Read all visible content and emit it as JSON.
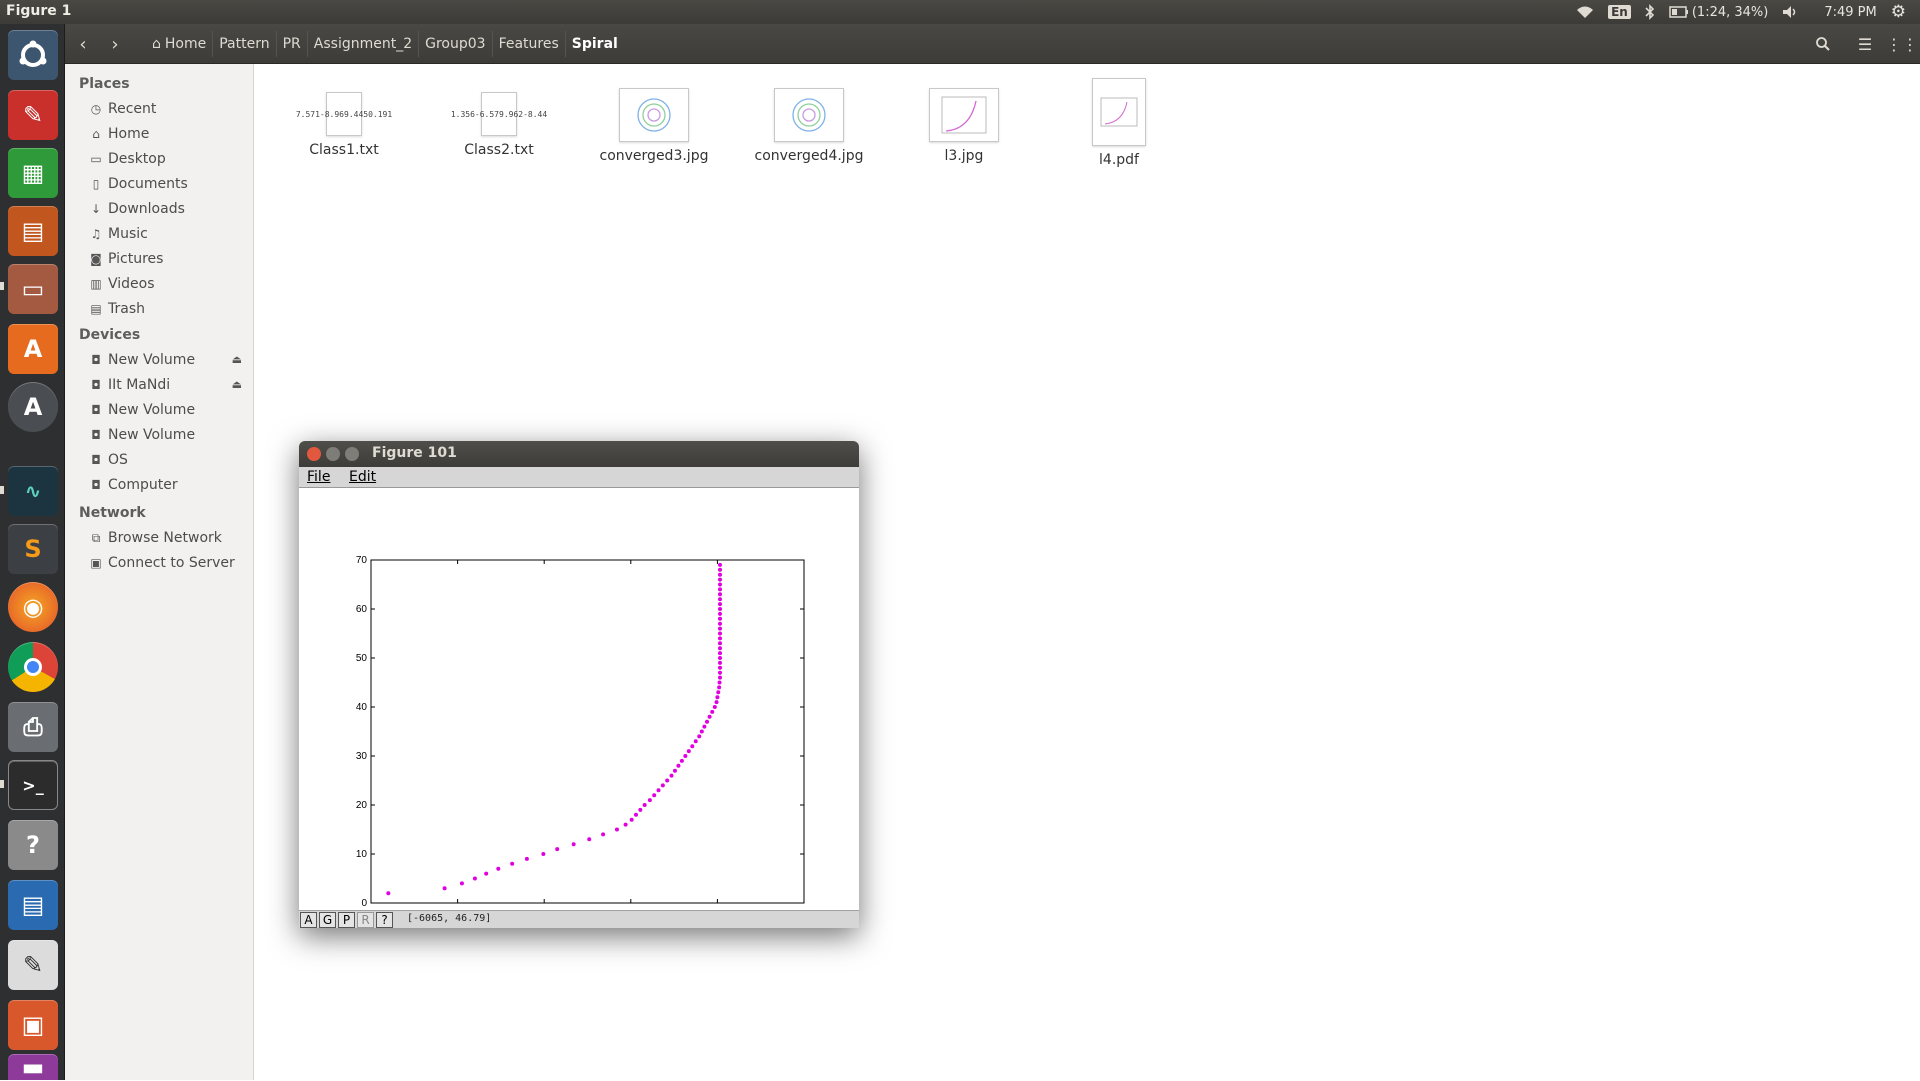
{
  "top_panel": {
    "window_title": "Figure 1",
    "indicators": {
      "language": "En",
      "battery": "(1:24, 34%)",
      "clock": "7:49 PM"
    }
  },
  "breadcrumb": [
    "Home",
    "Pattern",
    "PR",
    "Assignment_2",
    "Group03",
    "Features",
    "Spiral"
  ],
  "sidebar": {
    "places_heading": "Places",
    "places": [
      {
        "label": "Recent",
        "icon": "clock-icon"
      },
      {
        "label": "Home",
        "icon": "home-icon"
      },
      {
        "label": "Desktop",
        "icon": "folder-icon"
      },
      {
        "label": "Documents",
        "icon": "document-icon"
      },
      {
        "label": "Downloads",
        "icon": "download-icon"
      },
      {
        "label": "Music",
        "icon": "music-icon"
      },
      {
        "label": "Pictures",
        "icon": "camera-icon"
      },
      {
        "label": "Videos",
        "icon": "film-icon"
      },
      {
        "label": "Trash",
        "icon": "trash-icon"
      }
    ],
    "devices_heading": "Devices",
    "devices": [
      {
        "label": "New Volume",
        "eject": true
      },
      {
        "label": "IIt MaNdi",
        "eject": true
      },
      {
        "label": "New Volume",
        "eject": false
      },
      {
        "label": "New Volume",
        "eject": false
      },
      {
        "label": "OS",
        "eject": false
      },
      {
        "label": "Computer",
        "eject": false
      }
    ],
    "network_heading": "Network",
    "network": [
      {
        "label": "Browse Network",
        "icon": "network-icon"
      },
      {
        "label": "Connect to Server",
        "icon": "server-icon"
      }
    ]
  },
  "files": [
    {
      "name": "Class1.txt",
      "kind": "text",
      "preview": [
        "7.571",
        "-8.96",
        "9.445",
        "0.191"
      ]
    },
    {
      "name": "Class2.txt",
      "kind": "text",
      "preview": [
        "1.356",
        "-6.57",
        "9.962",
        "-8.44"
      ]
    },
    {
      "name": "converged3.jpg",
      "kind": "image"
    },
    {
      "name": "converged4.jpg",
      "kind": "image"
    },
    {
      "name": "l3.jpg",
      "kind": "image"
    },
    {
      "name": "l4.pdf",
      "kind": "pdf"
    }
  ],
  "figure": {
    "title": "Figure 101",
    "menu": [
      "File",
      "Edit"
    ],
    "status_buttons": [
      "A",
      "G",
      "P",
      "R",
      "?"
    ],
    "coordinates": "[-6065, 46.79]"
  },
  "chart_data": {
    "type": "scatter",
    "xlim": [
      -6200,
      -5700
    ],
    "ylim": [
      0,
      70
    ],
    "xticks": [
      -6200,
      -6100,
      -6000,
      -5900,
      -5800,
      -5700
    ],
    "yticks": [
      0,
      10,
      20,
      30,
      40,
      50,
      60,
      70
    ],
    "marker_color": "#e000e0",
    "x": [
      -6180,
      -6115,
      -6095,
      -6080,
      -6067,
      -6053,
      -6037,
      -6020,
      -6001,
      -5985,
      -5966,
      -5948,
      -5932,
      -5916,
      -5906,
      -5899,
      -5894,
      -5889,
      -5884,
      -5878,
      -5873,
      -5868,
      -5863,
      -5858,
      -5853,
      -5849,
      -5845,
      -5841,
      -5837,
      -5833,
      -5829,
      -5825,
      -5821,
      -5818,
      -5815,
      -5812,
      -5809,
      -5806,
      -5803,
      -5801,
      -5800,
      -5799,
      -5798,
      -5797.5,
      -5797,
      -5797,
      -5797,
      -5797,
      -5797,
      -5797,
      -5797,
      -5797,
      -5797,
      -5797,
      -5797,
      -5797,
      -5797,
      -5797,
      -5797,
      -5797,
      -5797,
      -5797,
      -5797,
      -5797,
      -5797,
      -5797,
      -5797,
      -5797
    ],
    "y": [
      2,
      3,
      4,
      5,
      6,
      7,
      8,
      9,
      10,
      11,
      12,
      13,
      14,
      15,
      16,
      17,
      18,
      19,
      20,
      21,
      22,
      23,
      24,
      25,
      26,
      27,
      28,
      29,
      30,
      31,
      32,
      33,
      34,
      35,
      36,
      37,
      38,
      39,
      40,
      41,
      42,
      43,
      44,
      45,
      46,
      47,
      48,
      49,
      50,
      51,
      52,
      53,
      54,
      55,
      56,
      57,
      58,
      59,
      60,
      61,
      62,
      63,
      64,
      65,
      66,
      67,
      68,
      69
    ]
  }
}
